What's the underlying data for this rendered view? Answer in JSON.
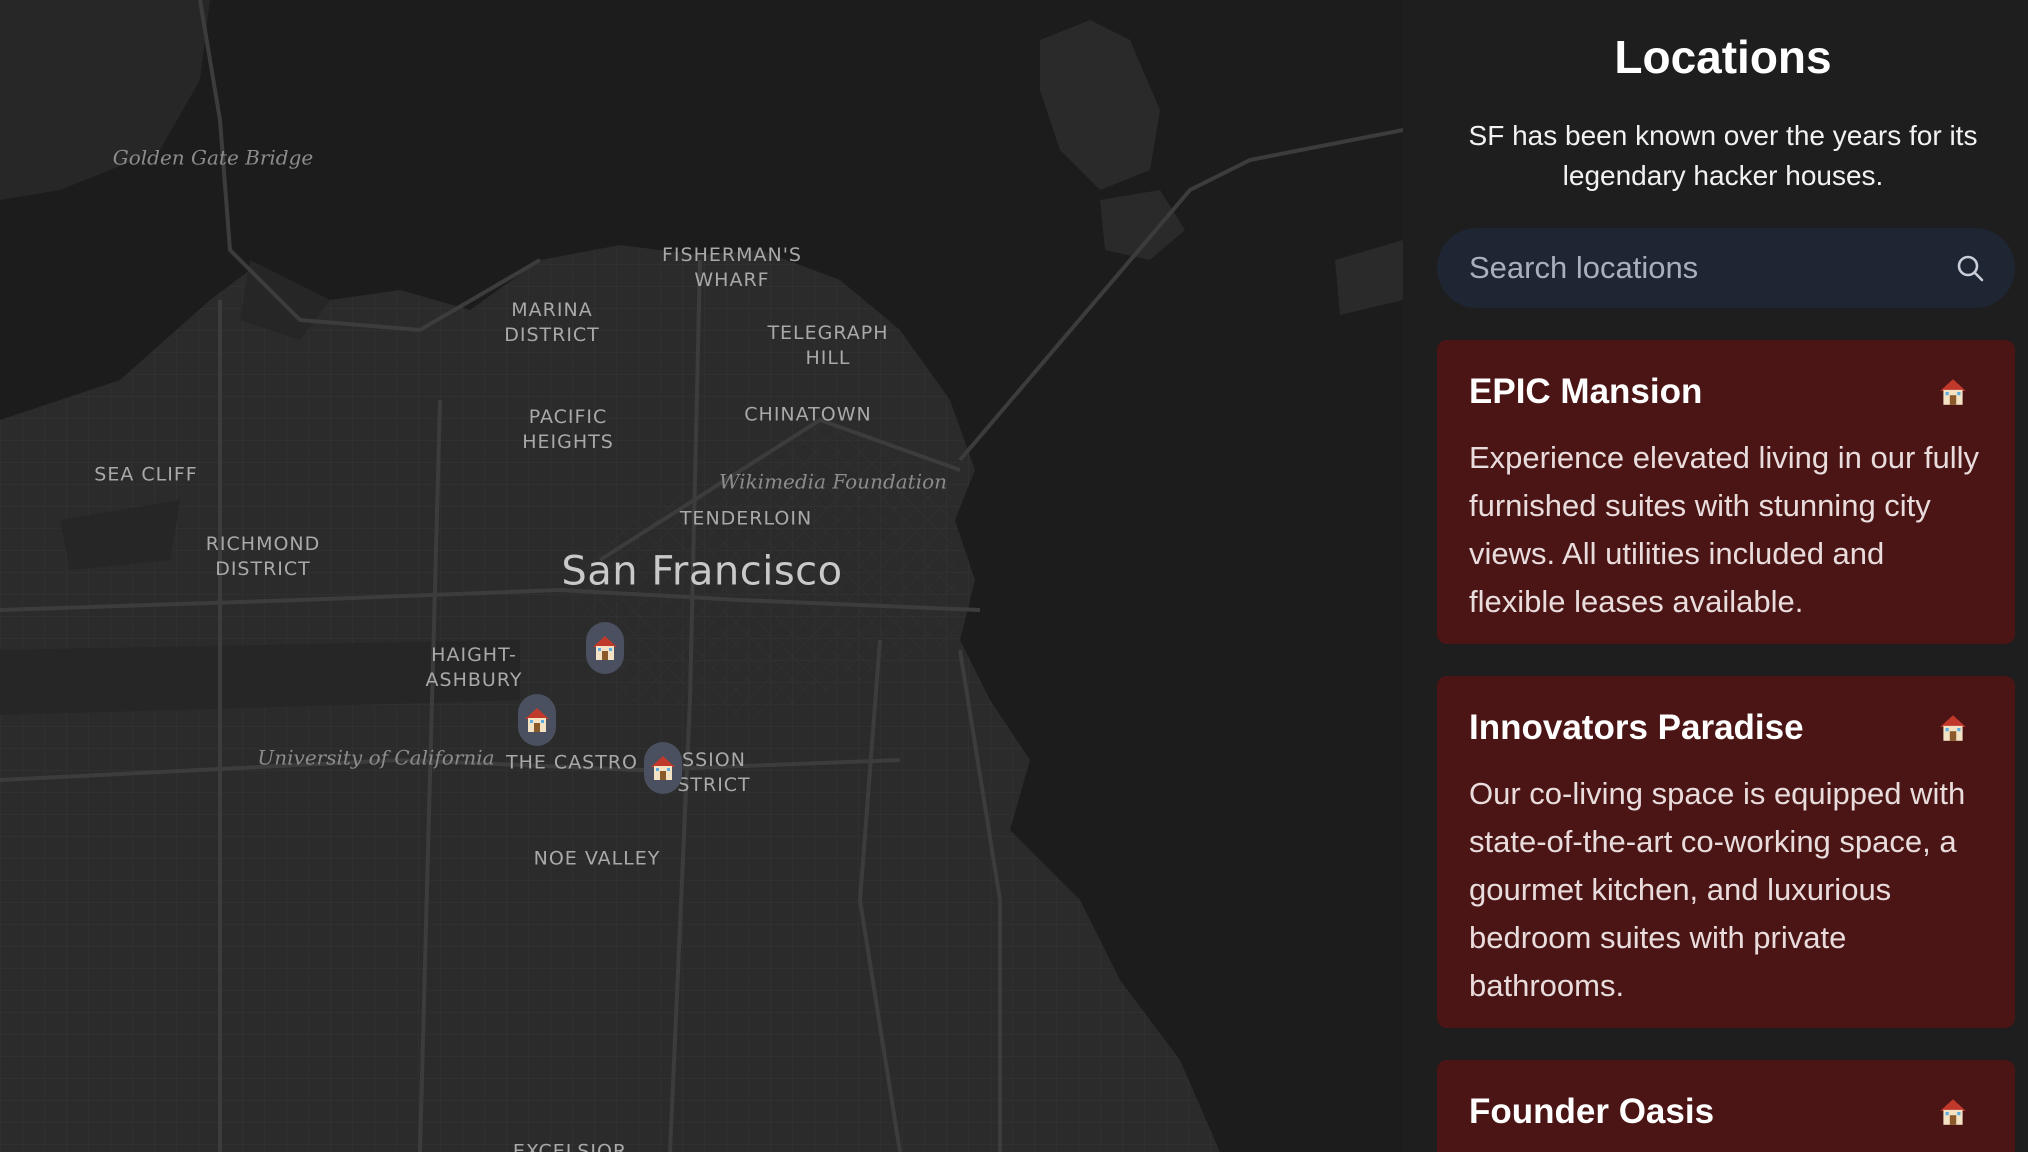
{
  "map": {
    "labels": {
      "golden_gate": "Golden Gate Bridge",
      "fishermans_wharf": "FISHERMAN'S\nWHARF",
      "marina": "MARINA\nDISTRICT",
      "telegraph": "TELEGRAPH\nHILL",
      "pacific_heights": "PACIFIC\nHEIGHTS",
      "chinatown": "CHINATOWN",
      "sea_cliff": "SEA CLIFF",
      "wikimedia": "Wikimedia Foundation",
      "tenderloin": "TENDERLOIN",
      "richmond": "RICHMOND\nDISTRICT",
      "city": "San Francisco",
      "haight": "HAIGHT-\nASHBURY",
      "university": "University of California",
      "castro": "THE CASTRO",
      "mission": "SSION\nSTRICT",
      "noe_valley": "NOE VALLEY",
      "excelsior": "EXCELSIOR"
    },
    "markers": [
      {
        "icon": "house-icon"
      },
      {
        "icon": "house-icon"
      },
      {
        "icon": "house-icon"
      }
    ]
  },
  "sidebar": {
    "title": "Locations",
    "subtitle": "SF has been known over the years for its legendary hacker houses.",
    "search": {
      "placeholder": "Search locations",
      "value": "",
      "icon": "search-icon"
    },
    "locations": [
      {
        "name": "EPIC Mansion",
        "description": "Experience elevated living in our fully furnished suites with stunning city views. All utilities included and flexible leases available.",
        "icon": "house-icon"
      },
      {
        "name": "Innovators Paradise",
        "description": "Our co-living space is equipped with state-of-the-art co-working space, a gourmet kitchen, and luxurious bedroom suites with private bathrooms.",
        "icon": "house-icon"
      },
      {
        "name": "Founder Oasis",
        "description": "",
        "icon": "house-icon"
      }
    ]
  },
  "colors": {
    "background": "#1e1e1e",
    "card": "#4b1515",
    "search": "#1f2633",
    "marker": "#4a5060"
  }
}
